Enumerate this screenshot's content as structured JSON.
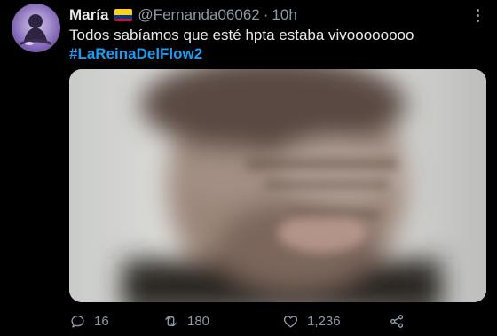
{
  "tweet": {
    "author": {
      "name": "María",
      "handle": "@Fernanda06062",
      "separator": "·",
      "time": "10h",
      "flag_colors": [
        "#fcd116",
        "#003893",
        "#ce1126"
      ]
    },
    "text": "Todos sabíamos que esté hpta estaba vivoooooooo",
    "hashtag": "#LaReinaDelFlow2",
    "media": {
      "icon": "blurred-photo"
    },
    "actions": {
      "replies": "16",
      "retweets": "180",
      "likes": "1,236"
    }
  },
  "colors": {
    "background": "#000000",
    "text": "#e7e9ea",
    "muted": "#8b98a5",
    "link": "#1d9bf0"
  }
}
